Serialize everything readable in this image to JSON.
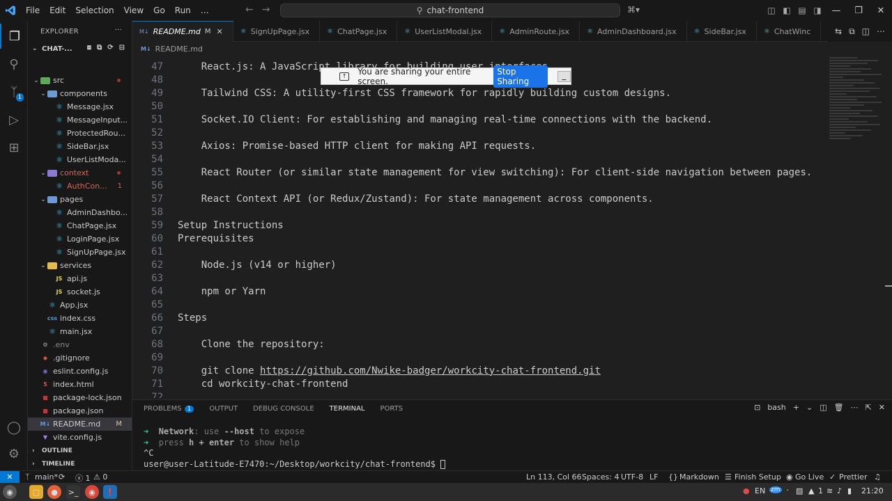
{
  "titlebar": {
    "menu": [
      "File",
      "Edit",
      "Selection",
      "View",
      "Go",
      "Run",
      "…"
    ],
    "search": "chat-frontend",
    "copilot": "⌘▾"
  },
  "activity": {
    "scm_badge": "1"
  },
  "explorer": {
    "title": "EXPLORER",
    "more": "···",
    "project": "CHAT-...",
    "tree": [
      {
        "label": "src",
        "kind": "folder-open",
        "depth": 1,
        "dot": true
      },
      {
        "label": "components",
        "kind": "folder-open",
        "depth": 2
      },
      {
        "label": "Message.jsx",
        "kind": "react",
        "depth": 3
      },
      {
        "label": "MessageInput...",
        "kind": "react",
        "depth": 3
      },
      {
        "label": "ProtectedRou...",
        "kind": "react",
        "depth": 3
      },
      {
        "label": "SideBar.jsx",
        "kind": "react",
        "depth": 3
      },
      {
        "label": "UserListModa...",
        "kind": "react",
        "depth": 3
      },
      {
        "label": "context",
        "kind": "folder-open",
        "depth": 2,
        "color": "#d06a5a",
        "dot": true
      },
      {
        "label": "AuthCon...",
        "kind": "react",
        "depth": 3,
        "color": "#d06a5a",
        "badge": "1"
      },
      {
        "label": "pages",
        "kind": "folder-open",
        "depth": 2
      },
      {
        "label": "AdminDashbo...",
        "kind": "react",
        "depth": 3
      },
      {
        "label": "ChatPage.jsx",
        "kind": "react",
        "depth": 3
      },
      {
        "label": "LoginPage.jsx",
        "kind": "react",
        "depth": 3
      },
      {
        "label": "SignUpPage.jsx",
        "kind": "react",
        "depth": 3
      },
      {
        "label": "services",
        "kind": "folder-open",
        "depth": 2
      },
      {
        "label": "api.js",
        "kind": "js",
        "depth": 3
      },
      {
        "label": "socket.js",
        "kind": "js",
        "depth": 3
      },
      {
        "label": "App.jsx",
        "kind": "react",
        "depth": 2
      },
      {
        "label": "index.css",
        "kind": "css",
        "depth": 2
      },
      {
        "label": "main.jsx",
        "kind": "react",
        "depth": 2
      },
      {
        "label": ".env",
        "kind": "gear",
        "depth": 1,
        "dim": true
      },
      {
        "label": ".gitignore",
        "kind": "git",
        "depth": 1
      },
      {
        "label": "eslint.config.js",
        "kind": "eslint",
        "depth": 1
      },
      {
        "label": "index.html",
        "kind": "html",
        "depth": 1
      },
      {
        "label": "package-lock.json",
        "kind": "npm",
        "depth": 1
      },
      {
        "label": "package.json",
        "kind": "npm",
        "depth": 1
      },
      {
        "label": "README.md",
        "kind": "md",
        "depth": 1,
        "selected": true,
        "badge": "M"
      },
      {
        "label": "vite.config.js",
        "kind": "vite",
        "depth": 1
      }
    ],
    "outline": "OUTLINE",
    "timeline": "TIMELINE"
  },
  "tabs": [
    {
      "label": "README.md",
      "mod": "M",
      "active": true,
      "icon": "md"
    },
    {
      "label": "SignUpPage.jsx",
      "icon": "react"
    },
    {
      "label": "ChatPage.jsx",
      "icon": "react"
    },
    {
      "label": "UserListModal.jsx",
      "icon": "react"
    },
    {
      "label": "AdminRoute.jsx",
      "icon": "react"
    },
    {
      "label": "AdminDashboard.jsx",
      "icon": "react"
    },
    {
      "label": "SideBar.jsx",
      "icon": "react"
    },
    {
      "label": "ChatWinc",
      "icon": "react"
    }
  ],
  "breadcrumb": "README.md",
  "editor": {
    "lines": [
      {
        "n": "47",
        "text": "    React.js: A JavaScript library for building user interfaces."
      },
      {
        "n": "48",
        "text": ""
      },
      {
        "n": "49",
        "text": "    Tailwind CSS: A utility-first CSS framework for rapidly building custom designs."
      },
      {
        "n": "50",
        "text": ""
      },
      {
        "n": "51",
        "text": "    Socket.IO Client: For establishing and managing real-time connections with the backend."
      },
      {
        "n": "52",
        "text": ""
      },
      {
        "n": "53",
        "text": "    Axios: Promise-based HTTP client for making API requests."
      },
      {
        "n": "54",
        "text": ""
      },
      {
        "n": "55",
        "text": "    React Router (or similar state management for view switching): For client-side navigation between pages."
      },
      {
        "n": "56",
        "text": ""
      },
      {
        "n": "57",
        "text": "    React Context API (or Redux/Zustand): For state management across components."
      },
      {
        "n": "58",
        "text": ""
      },
      {
        "n": "59",
        "text": "Setup Instructions"
      },
      {
        "n": "60",
        "text": "Prerequisites"
      },
      {
        "n": "61",
        "text": ""
      },
      {
        "n": "62",
        "text": "    Node.js (v14 or higher)"
      },
      {
        "n": "63",
        "text": ""
      },
      {
        "n": "64",
        "text": "    npm or Yarn"
      },
      {
        "n": "65",
        "text": ""
      },
      {
        "n": "66",
        "text": "Steps"
      },
      {
        "n": "67",
        "text": ""
      },
      {
        "n": "68",
        "text": "    Clone the repository:"
      },
      {
        "n": "69",
        "text": ""
      },
      {
        "n": "70",
        "text": "    git clone ",
        "link": "https://github.com/Nwike-badger/workcity-chat-frontend.git"
      },
      {
        "n": "71",
        "text": "    cd workcity-chat-frontend"
      },
      {
        "n": "72",
        "text": ""
      }
    ]
  },
  "share": {
    "message": "You are sharing your entire screen.",
    "stop": "Stop Sharing",
    "minimize": "_"
  },
  "panel": {
    "tabs": [
      "PROBLEMS",
      "OUTPUT",
      "DEBUG CONSOLE",
      "TERMINAL",
      "PORTS"
    ],
    "problems_badge": "1",
    "shell": "bash",
    "term": {
      "l1_arrow": "➜",
      "l1_label": "Network",
      "l1_rest": ": use ",
      "l1_flag": "--host",
      "l1_end": " to expose",
      "l2_arrow": "➜",
      "l2_a": "press ",
      "l2_b": "h + enter",
      "l2_c": " to show help",
      "l3": "^C",
      "prompt": "user@user-Latitude-E7470:~/Desktop/workcity/chat-frontend$ "
    }
  },
  "status": {
    "remote": "✕",
    "branch": "main*",
    "sync": "⟳",
    "errors": "ⓧ 1",
    "warnings": "⚠ 0",
    "position": "Ln 113, Col 66",
    "spaces": "Spaces: 4",
    "encoding": "UTF-8",
    "eol": "LF",
    "language": "Markdown",
    "finish": "Finish Setup",
    "golive": "Go Live",
    "prettier": "Prettier"
  },
  "taskbar": {
    "lang": "EN",
    "zoom": "zm",
    "num": "1",
    "time": "21:20"
  },
  "colors": {
    "accent": "#0078d4",
    "editor_bg": "#1f1f1f",
    "sidebar_bg": "#181818",
    "stop_button": "#1a73e8"
  }
}
